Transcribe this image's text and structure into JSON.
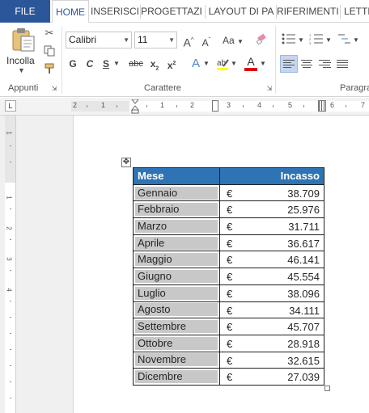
{
  "tabs": [
    "FILE",
    "HOME",
    "INSERISCI",
    "PROGETTAZI",
    "LAYOUT DI PA",
    "RIFERIMENTI",
    "LETTE"
  ],
  "clipboard": {
    "paste_label": "Incolla",
    "group_label": "Appunti"
  },
  "font": {
    "family": "Calibri",
    "size": "11",
    "group_label": "Carattere"
  },
  "format_buttons": {
    "grow": "A",
    "shrink": "A",
    "case": "Aa",
    "bold": "G",
    "italic": "C",
    "underline": "S",
    "strike": "abc",
    "sub": "x",
    "sup": "x",
    "font_color": "A"
  },
  "paragraph": {
    "group_label": "Paragra"
  },
  "ruler": {
    "marks": [
      "2",
      "1",
      "1",
      "2",
      "3",
      "4",
      "5",
      "6",
      "7"
    ],
    "vertical_marks": [
      "1",
      "1",
      "2",
      "3",
      "4"
    ]
  },
  "table": {
    "headers": [
      "Mese",
      "Incasso"
    ],
    "currency": "€",
    "rows": [
      {
        "month": "Gennaio",
        "amount": "38.709"
      },
      {
        "month": "Febbraio",
        "amount": "25.976"
      },
      {
        "month": "Marzo",
        "amount": "31.711"
      },
      {
        "month": "Aprile",
        "amount": "36.617"
      },
      {
        "month": "Maggio",
        "amount": "46.141"
      },
      {
        "month": "Giugno",
        "amount": "45.554"
      },
      {
        "month": "Luglio",
        "amount": "38.096"
      },
      {
        "month": "Agosto",
        "amount": "34.111"
      },
      {
        "month": "Settembre",
        "amount": "45.707"
      },
      {
        "month": "Ottobre",
        "amount": "28.918"
      },
      {
        "month": "Novembre",
        "amount": "32.615"
      },
      {
        "month": "Dicembre",
        "amount": "27.039"
      }
    ]
  },
  "colors": {
    "accent": "#2b579a",
    "header_fill": "#2e74b5",
    "cell_highlight": "#c8c8c8",
    "font_color_bar": "#e00000"
  }
}
